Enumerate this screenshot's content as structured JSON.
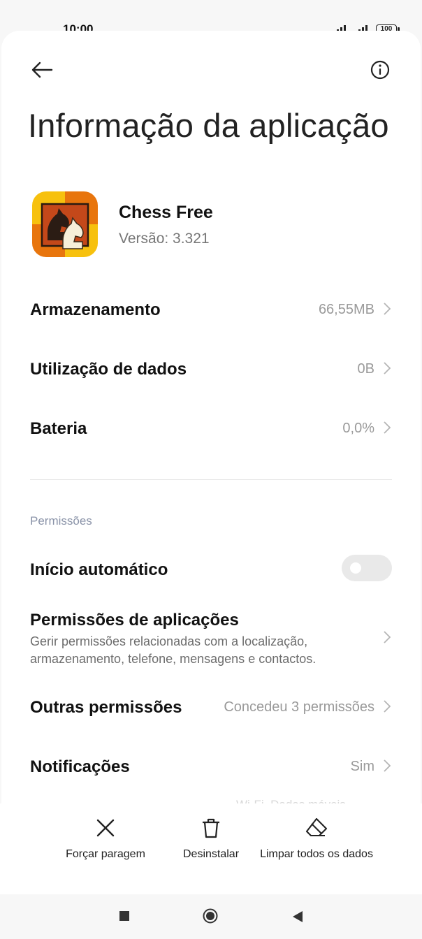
{
  "status_bar": {
    "time": "10:00",
    "battery": "100"
  },
  "header": {
    "title": "Informação da aplicação"
  },
  "app": {
    "name": "Chess Free",
    "version": "Versão: 3.321"
  },
  "rows": {
    "storage": {
      "label": "Armazenamento",
      "value": "66,55MB"
    },
    "data_usage": {
      "label": "Utilização de dados",
      "value": "0B"
    },
    "battery": {
      "label": "Bateria",
      "value": "0,0%"
    }
  },
  "permissions": {
    "section_title": "Permissões",
    "autostart": {
      "label": "Início automático",
      "enabled": false
    },
    "app_permissions": {
      "label": "Permissões de aplicações",
      "description": "Gerir permissões relacionadas com a localização, armazenamento, telefone, mensagens e contactos."
    },
    "other": {
      "label": "Outras permissões",
      "value": "Concedeu 3 permissões"
    },
    "notifications": {
      "label": "Notificações",
      "value": "Sim"
    },
    "partial_next": "Wi-Fi, Dados móveis"
  },
  "actions": {
    "force_stop": "Forçar paragem",
    "uninstall": "Desinstalar",
    "clear_data": "Limpar todos os dados"
  },
  "icons": [
    "back-arrow-icon",
    "info-icon",
    "chevron-right-icon",
    "close-x-icon",
    "trash-icon",
    "eraser-icon"
  ],
  "colors": {
    "accent_muted": "#8a93a8",
    "value_gray": "#9a9a9a"
  }
}
